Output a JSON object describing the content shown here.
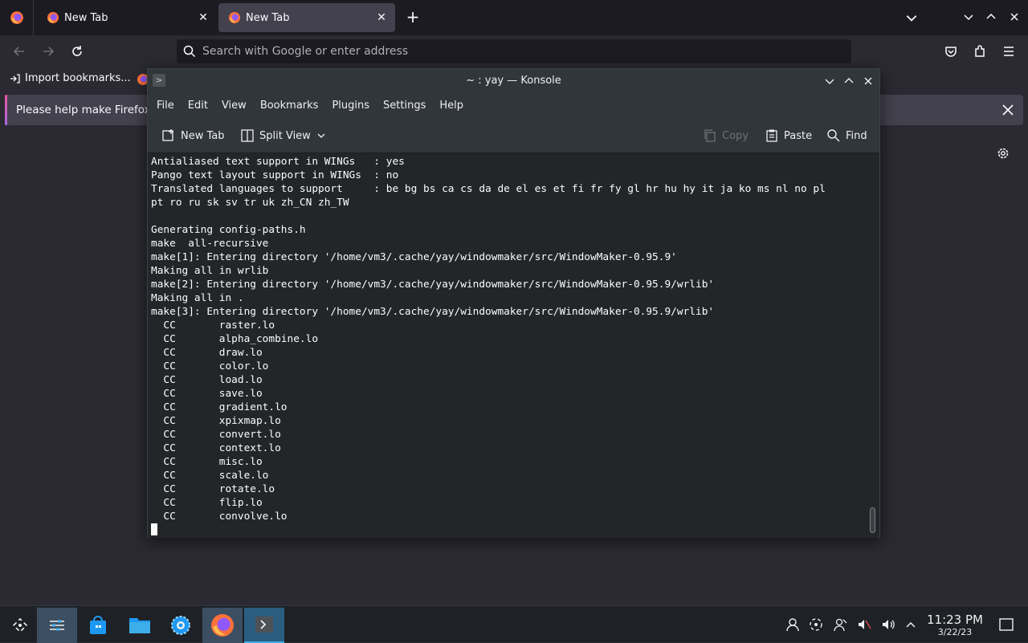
{
  "firefox": {
    "tabs": [
      {
        "label": "New Tab"
      },
      {
        "label": "New Tab"
      }
    ],
    "urlbar_placeholder": "Search with Google or enter address",
    "bookmark_import_label": "Import bookmarks...",
    "notification_text": "Please help make Firefox b"
  },
  "konsole": {
    "title": "~ : yay — Konsole",
    "menu": [
      "File",
      "Edit",
      "View",
      "Bookmarks",
      "Plugins",
      "Settings",
      "Help"
    ],
    "toolbar": {
      "new_tab": "New Tab",
      "split_view": "Split View",
      "copy": "Copy",
      "paste": "Paste",
      "find": "Find"
    },
    "terminal_lines": [
      "Antialiased text support in WINGs   : yes",
      "Pango text layout support in WINGs  : no",
      "Translated languages to support     : be bg bs ca cs da de el es et fi fr fy gl hr hu hy it ja ko ms nl no pl",
      "pt ro ru sk sv tr uk zh_CN zh_TW",
      "",
      "Generating config-paths.h",
      "make  all-recursive",
      "make[1]: Entering directory '/home/vm3/.cache/yay/windowmaker/src/WindowMaker-0.95.9'",
      "Making all in wrlib",
      "make[2]: Entering directory '/home/vm3/.cache/yay/windowmaker/src/WindowMaker-0.95.9/wrlib'",
      "Making all in .",
      "make[3]: Entering directory '/home/vm3/.cache/yay/windowmaker/src/WindowMaker-0.95.9/wrlib'",
      "  CC       raster.lo",
      "  CC       alpha_combine.lo",
      "  CC       draw.lo",
      "  CC       color.lo",
      "  CC       load.lo",
      "  CC       save.lo",
      "  CC       gradient.lo",
      "  CC       xpixmap.lo",
      "  CC       convert.lo",
      "  CC       context.lo",
      "  CC       misc.lo",
      "  CC       scale.lo",
      "  CC       rotate.lo",
      "  CC       flip.lo",
      "  CC       convolve.lo"
    ]
  },
  "taskbar": {
    "time": "11:23 PM",
    "date": "3/22/23"
  },
  "icons": {
    "launcher": "plasma-launcher-icon",
    "pager": "virtual-desktops-icon",
    "discover": "discover-store-icon",
    "files": "dolphin-folder-icon",
    "settings": "system-settings-icon",
    "firefox": "firefox-icon",
    "konsole": "konsole-icon"
  },
  "colors": {
    "firefox_dark": "#1c1b22",
    "firefox_tab_active": "#42414d",
    "konsole_bg": "#232629",
    "breeze_titlebar": "#31363b",
    "taskbar_bg": "#1e2226",
    "taskbar_active": "#3daee9"
  }
}
